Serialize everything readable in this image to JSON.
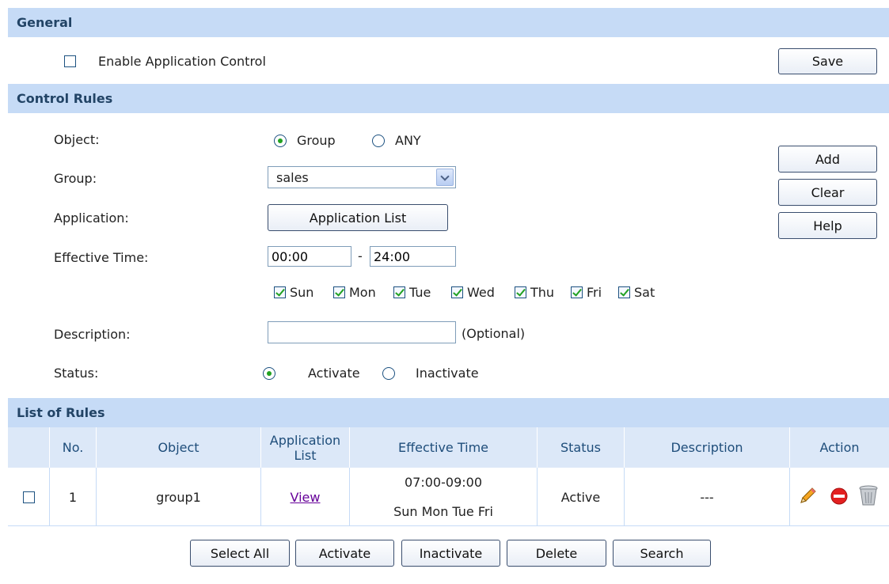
{
  "general": {
    "header": "General",
    "enable_label": "Enable Application Control",
    "save_label": "Save"
  },
  "control_rules": {
    "header": "Control Rules",
    "object_label": "Object:",
    "object_options": [
      "Group",
      "ANY"
    ],
    "object_selected": "Group",
    "group_label": "Group:",
    "group_value": "sales",
    "application_label": "Application:",
    "application_button": "Application List",
    "effective_time_label": "Effective Time:",
    "time_start": "00:00",
    "time_separator": "-",
    "time_end": "24:00",
    "days": [
      {
        "label": "Sun",
        "checked": true
      },
      {
        "label": "Mon",
        "checked": true
      },
      {
        "label": "Tue",
        "checked": true
      },
      {
        "label": "Wed",
        "checked": true
      },
      {
        "label": "Thu",
        "checked": true
      },
      {
        "label": "Fri",
        "checked": true
      },
      {
        "label": "Sat",
        "checked": true
      }
    ],
    "description_label": "Description:",
    "description_value": "",
    "optional_label": "(Optional)",
    "status_label": "Status:",
    "status_options": [
      "Activate",
      "Inactivate"
    ],
    "status_selected": "Activate",
    "add_label": "Add",
    "clear_label": "Clear",
    "help_label": "Help"
  },
  "list_of_rules": {
    "header": "List of Rules",
    "columns": [
      "No.",
      "Object",
      "Application List",
      "Effective Time",
      "Status",
      "Description",
      "Action"
    ],
    "rows": [
      {
        "no": "1",
        "object": "group1",
        "application_list": "View",
        "time": "07:00-09:00",
        "days": "Sun Mon Tue Fri",
        "status": "Active",
        "description": "---"
      }
    ],
    "buttons": {
      "select_all": "Select All",
      "activate": "Activate",
      "inactivate": "Inactivate",
      "delete": "Delete",
      "search": "Search"
    }
  },
  "icons": [
    "pencil-icon",
    "no-entry-icon",
    "trash-icon"
  ],
  "colors": {
    "section_header_bg": "#c6dbf6",
    "header_text": "#224466",
    "check_green": "#21a121",
    "link_purple": "#660099"
  }
}
